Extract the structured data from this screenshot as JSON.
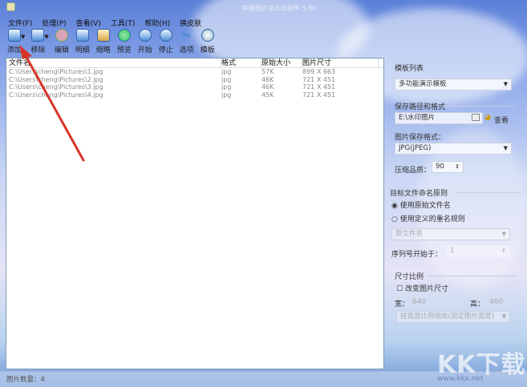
{
  "title": "中格图片加水印软件 5.80",
  "menu": [
    "文件(F)",
    "处理(P)",
    "查看(V)",
    "工具(T)",
    "帮助(H)",
    "换皮肤"
  ],
  "toolbar": [
    "添加",
    "移除",
    "编辑",
    "明细",
    "缩略",
    "预览",
    "开始",
    "停止",
    "选项",
    "模板"
  ],
  "list": {
    "headers": [
      "文件名",
      "格式",
      "原始大小",
      "图片尺寸"
    ],
    "rows": [
      [
        "C:\\Users\\cheng\\Pictures\\1.jpg",
        "jpg",
        "57K",
        "899 X 663"
      ],
      [
        "C:\\Users\\cheng\\Pictures\\2.jpg",
        "jpg",
        "46K",
        "721 X 451"
      ],
      [
        "C:\\Users\\cheng\\Pictures\\3.jpg",
        "jpg",
        "46K",
        "721 X 451"
      ],
      [
        "C:\\Users\\cheng\\Pictures\\4.jpg",
        "jpg",
        "45K",
        "721 X 451"
      ]
    ]
  },
  "right": {
    "template_label": "模板列表",
    "template_value": "多功能演示模板",
    "save_label": "保存路径和格式",
    "save_path": "E:\\水印图片",
    "view_label": "查看",
    "format_label": "图片保存格式：",
    "format_value": "JPG(JPEG)",
    "quality_label": "压缩品质：",
    "quality_value": "90",
    "naming_label": "目标文件命名原则",
    "radio_original": "使用原始文件名",
    "radio_custom": "使用定义的重名规则",
    "naming_value": "原文件名",
    "seq_label": "序列号开始于：",
    "seq_value": "1",
    "size_label": "尺寸比例",
    "resize_label": "改变图片尺寸",
    "width_label": "宽：",
    "width_value": "640",
    "height_label": "高：",
    "height_value": "480",
    "scale_value": "按宽度比例缩放(固定图片宽度)"
  },
  "status": "图片数量：4",
  "watermark": "KK下载",
  "watermark_url": "www.kkx.net"
}
